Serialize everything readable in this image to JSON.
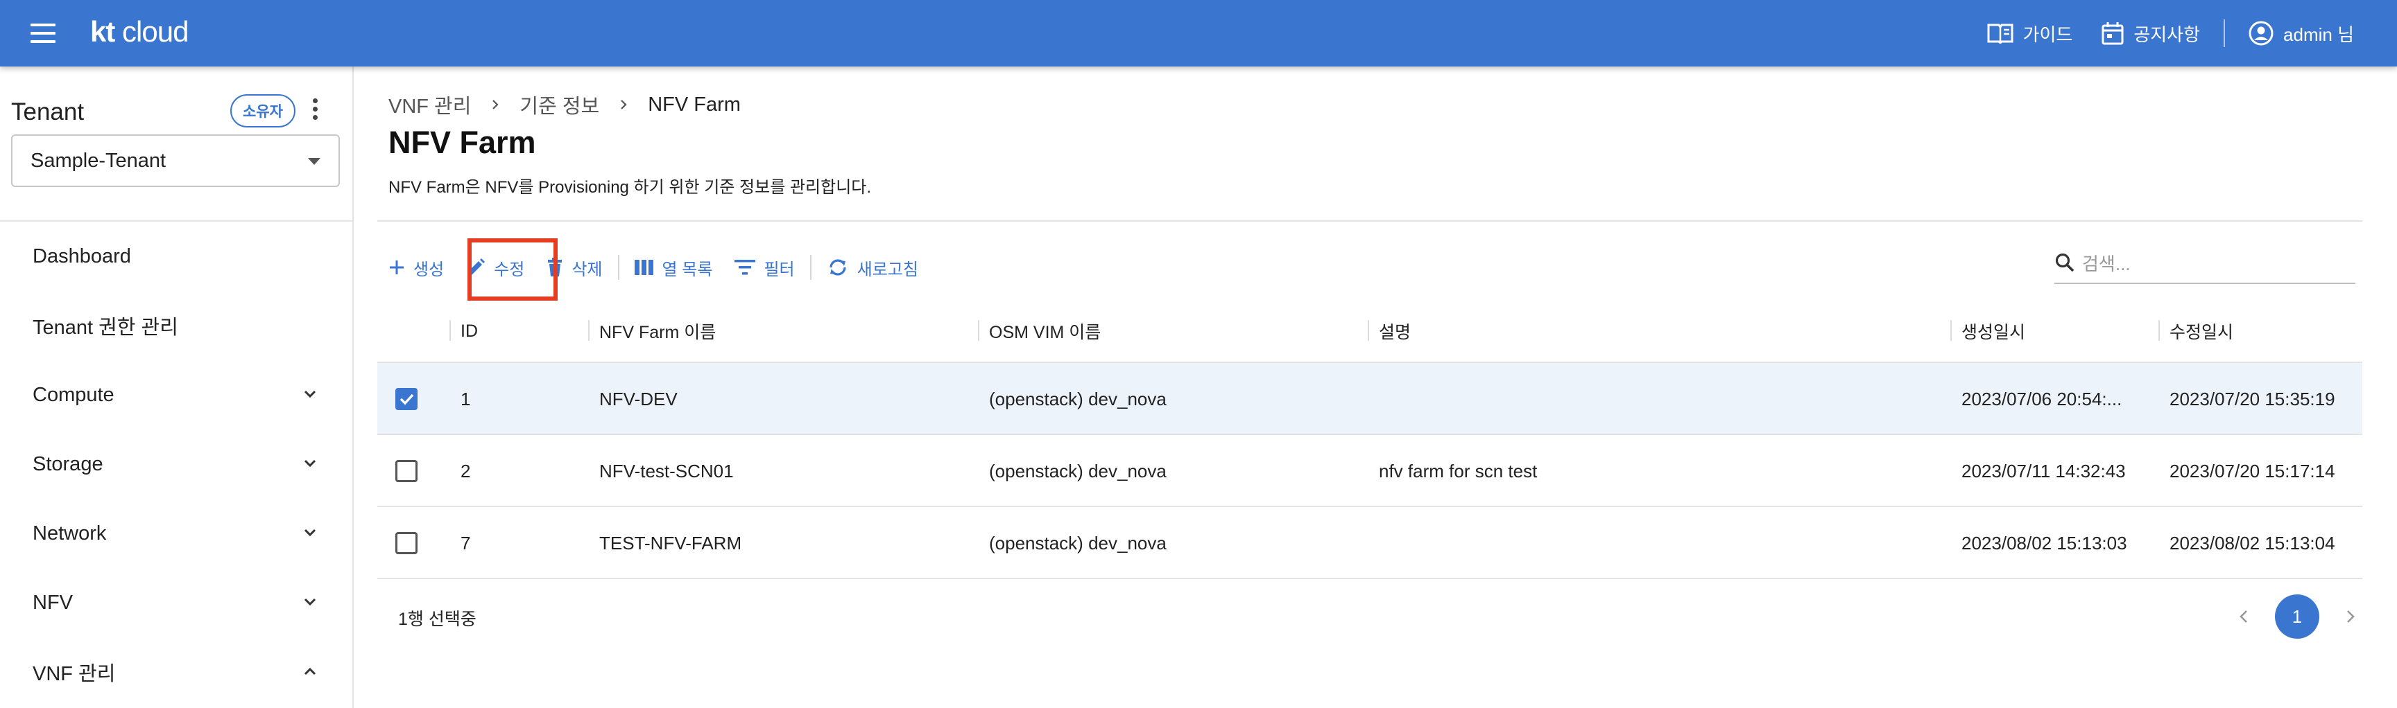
{
  "colors": {
    "brand": "#3a76cf",
    "highlight": "#e53d22",
    "selected_row": "#edf3fb"
  },
  "topbar": {
    "logo_kt": "kt",
    "logo_cloud": " cloud",
    "guide_label": "가이드",
    "notice_label": "공지사항",
    "user_label": "admin 님",
    "icons": [
      "menu-icon",
      "book-icon",
      "calendar-icon",
      "account-circle-icon"
    ]
  },
  "sidebar": {
    "tenant_title": "Tenant",
    "owner_badge": "소유자",
    "tenant_selected": "Sample-Tenant",
    "items": [
      {
        "label": "Dashboard",
        "chevron": ""
      },
      {
        "label": "Tenant 권한 관리",
        "chevron": ""
      },
      {
        "label": "Compute",
        "chevron": "down"
      },
      {
        "label": "Storage",
        "chevron": "down"
      },
      {
        "label": "Network",
        "chevron": "down"
      },
      {
        "label": "NFV",
        "chevron": "down"
      },
      {
        "label": "VNF 관리",
        "chevron": "up"
      }
    ]
  },
  "main": {
    "breadcrumb": [
      "VNF 관리",
      "기준 정보",
      "NFV Farm"
    ],
    "title": "NFV Farm",
    "description": "NFV Farm은 NFV를 Provisioning 하기 위한 기준 정보를 관리합니다.",
    "toolbar": {
      "create": "생성",
      "edit": "수정",
      "delete": "삭제",
      "columns": "열 목록",
      "filter": "필터",
      "refresh": "새로고침"
    },
    "search_placeholder": "검색..."
  },
  "table": {
    "columns": [
      "ID",
      "NFV Farm 이름",
      "OSM VIM 이름",
      "설명",
      "생성일시",
      "수정일시"
    ],
    "rows": [
      {
        "checked": true,
        "id": "1",
        "name": "NFV-DEV",
        "vim": "(openstack) dev_nova",
        "desc": "",
        "created": "2023/07/06 20:54:...",
        "updated": "2023/07/20 15:35:19"
      },
      {
        "checked": false,
        "id": "2",
        "name": "NFV-test-SCN01",
        "vim": "(openstack) dev_nova",
        "desc": "nfv farm for scn test",
        "created": "2023/07/11 14:32:43",
        "updated": "2023/07/20 15:17:14"
      },
      {
        "checked": false,
        "id": "7",
        "name": "TEST-NFV-FARM",
        "vim": "(openstack) dev_nova",
        "desc": "",
        "created": "2023/08/02 15:13:03",
        "updated": "2023/08/02 15:13:04"
      }
    ],
    "selection_text": "1행 선택중",
    "current_page": "1"
  }
}
